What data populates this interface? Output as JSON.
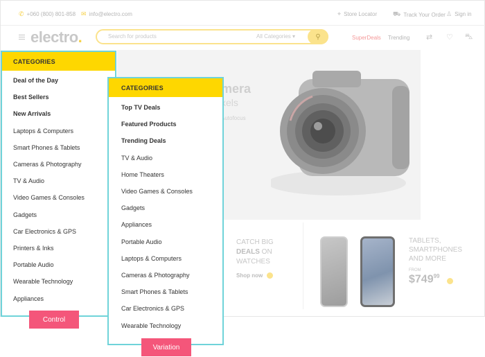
{
  "topbar": {
    "phone": "+060 (800) 801-858",
    "email": "info@electro.com",
    "store_locator": "Store Locator",
    "track_order": "Track Your Order",
    "sign_in": "Sign in"
  },
  "header": {
    "logo": "electro",
    "logo_dot": ".",
    "search_placeholder": "Search for products",
    "search_category": "All Categories",
    "superdeals": "SuperDeals",
    "trending": "Trending"
  },
  "hero": {
    "title": "mera",
    "subtitle": "xels",
    "tagline": "Autofocus"
  },
  "promos": [
    {
      "line1": "CATCH BIG",
      "bold": "DEALS",
      "line2": " ON",
      "line3": "WATCHES",
      "cta": "Shop now"
    },
    {
      "line1": "TABLETS,",
      "line2": "SMARTPHONES",
      "line3": "AND MORE",
      "from": "FROM",
      "price": "$749",
      "cents": "99"
    }
  ],
  "control": {
    "heading": "CATEGORIES",
    "items": [
      "Deal of the Day",
      "Best Sellers",
      "New Arrivals",
      "Laptops & Computers",
      "Smart Phones & Tablets",
      "Cameras & Photography",
      "TV & Audio",
      "Video Games & Consoles",
      "Gadgets",
      "Car Electronics & GPS",
      "Printers & Inks",
      "Portable Audio",
      "Wearable Technology",
      "Appliances"
    ],
    "tag": "Control"
  },
  "variation": {
    "heading": "CATEGORIES",
    "items": [
      "Top TV Deals",
      "Featured Products",
      "Trending Deals",
      "TV & Audio",
      "Home Theaters",
      "Video Games & Consoles",
      "Gadgets",
      "Appliances",
      "Portable Audio",
      "Laptops & Computers",
      "Cameras & Photography",
      "Smart Phones & Tablets",
      "Car Electronics & GPS",
      "Wearable Technology"
    ],
    "tag": "Variation"
  },
  "colors": {
    "accent": "#fed700",
    "panel_border": "#6fd3d9",
    "tag": "#f4567a"
  }
}
